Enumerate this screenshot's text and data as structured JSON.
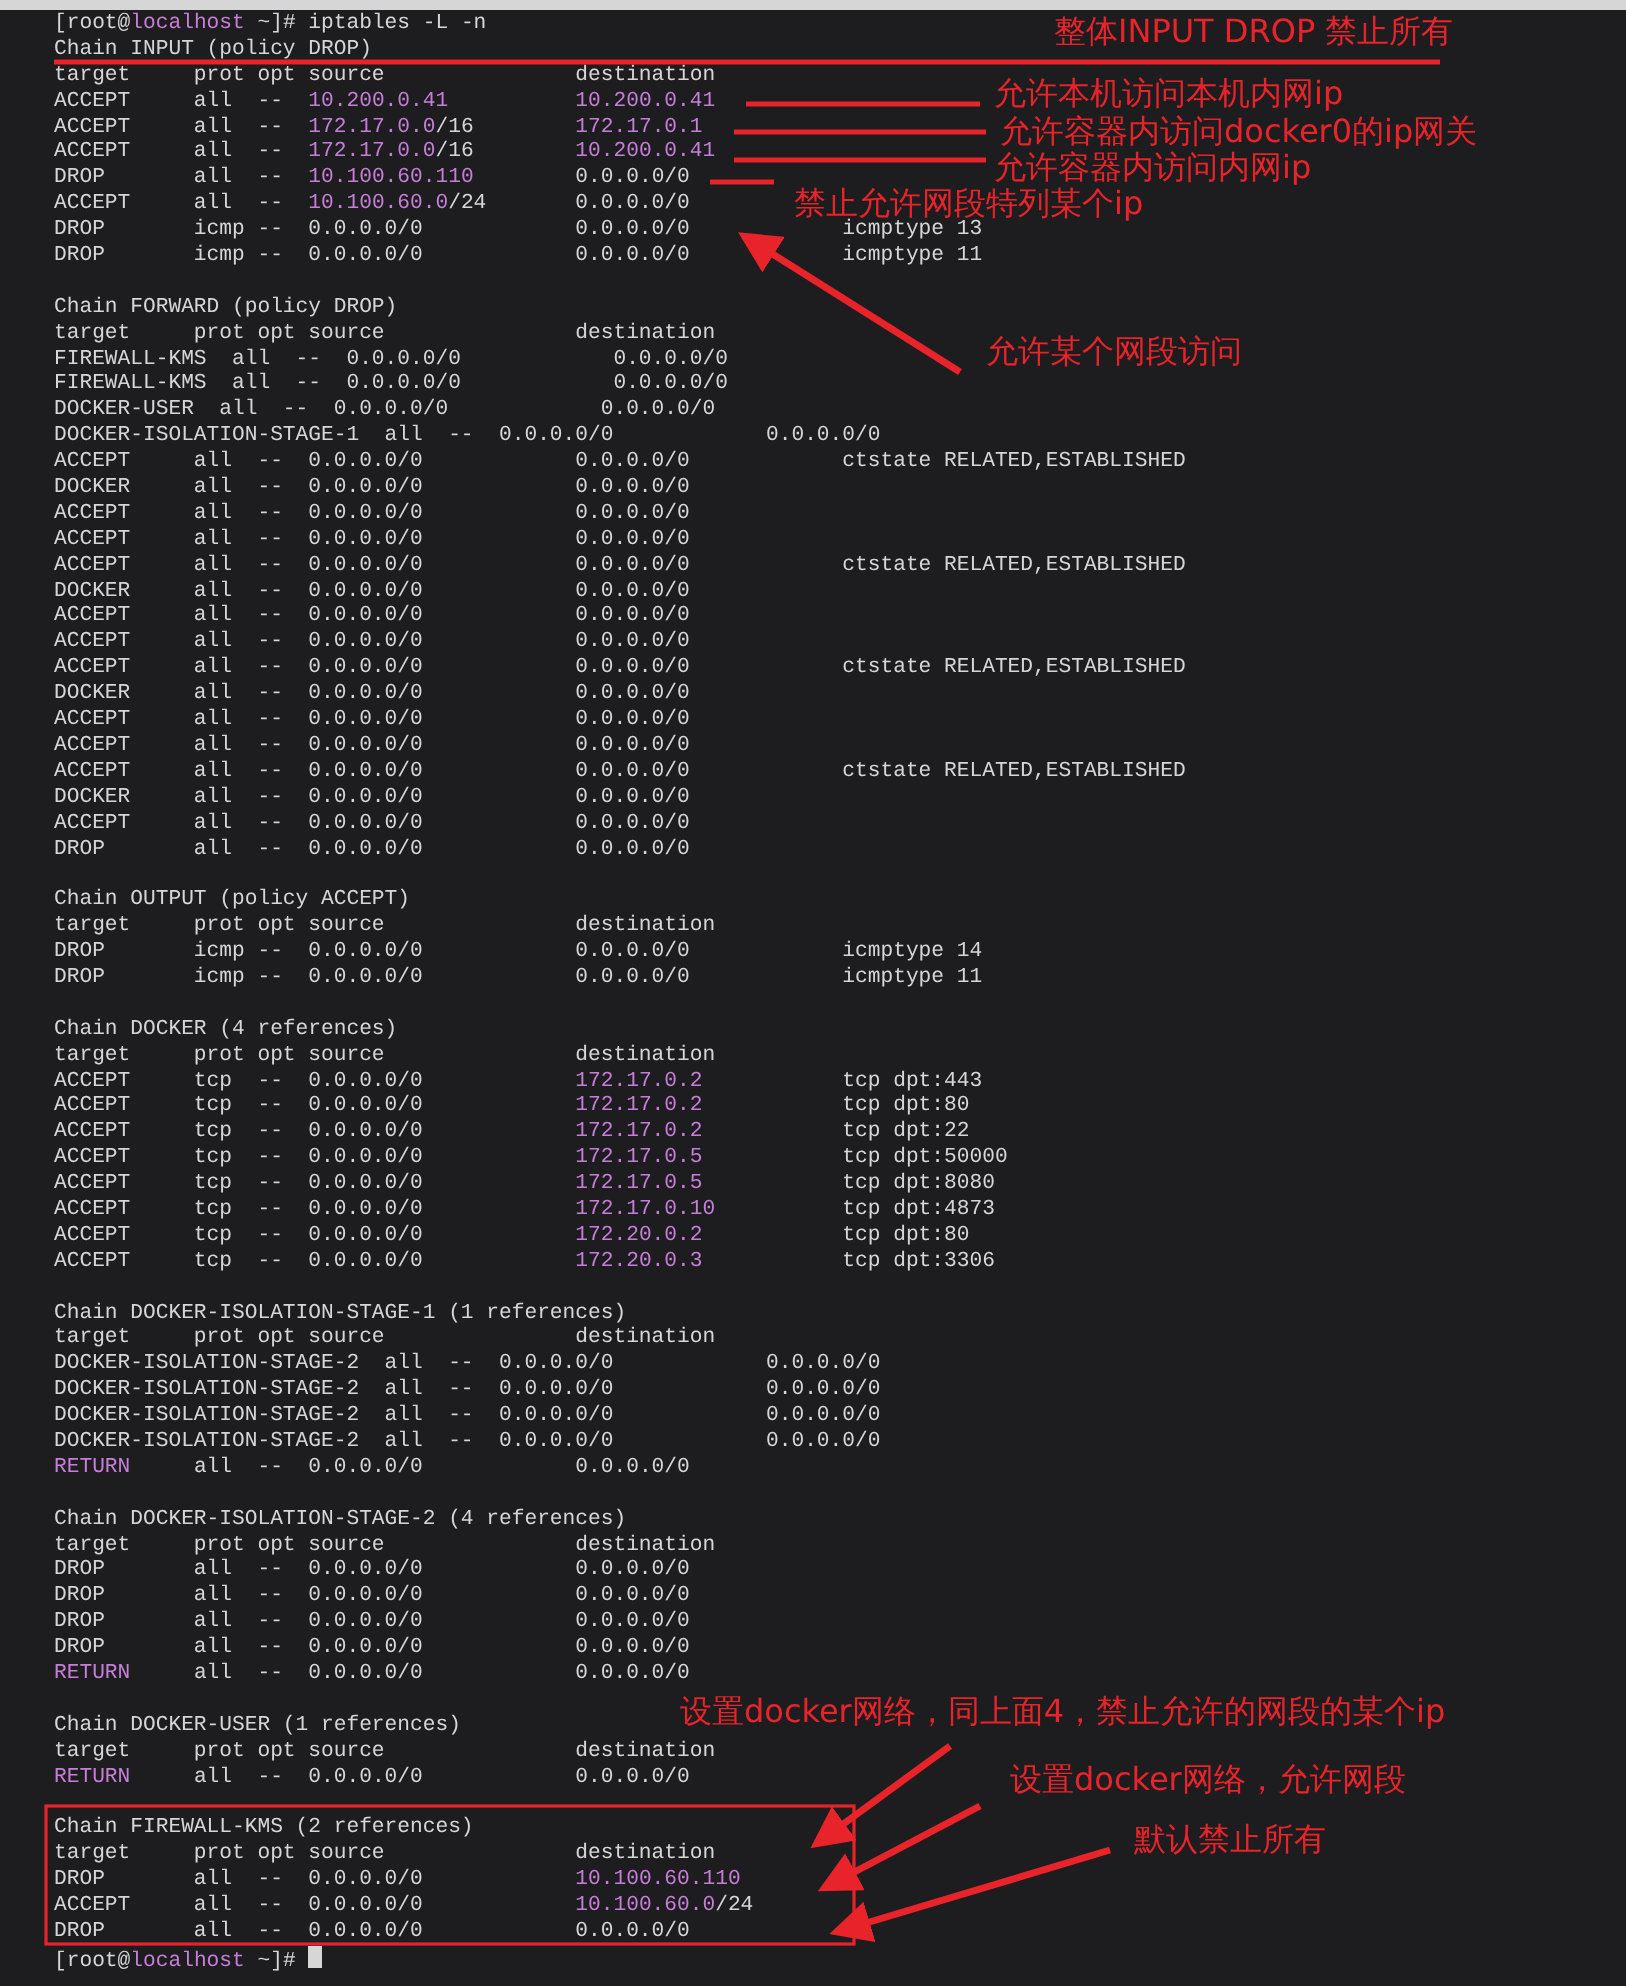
{
  "terminal": {
    "lines": [
      {
        "kind": "command",
        "parts": [
          {
            "text": "[root@",
            "highlight": false
          },
          {
            "text": "localhost",
            "highlight": true
          },
          {
            "text": " ~]# iptables -L -n",
            "highlight": false
          }
        ]
      },
      {
        "kind": "output",
        "text": "Chain INPUT (policy DROP)"
      },
      {
        "kind": "output",
        "text": "target     prot opt source               destination"
      },
      {
        "kind": "output",
        "parts": [
          {
            "text": "ACCEPT     all  --  ",
            "highlight": false
          },
          {
            "text": "10.200.0.41",
            "highlight": true
          },
          {
            "text": "          10.200.0.41",
            "highlight": true
          }
        ]
      },
      {
        "kind": "output",
        "parts": [
          {
            "text": "ACCEPT     all  --  ",
            "highlight": false
          },
          {
            "text": "172.17.0.0",
            "highlight": true
          },
          {
            "text": "/16        ",
            "highlight": false
          },
          {
            "text": "172.17.0.1",
            "highlight": true
          }
        ]
      },
      {
        "kind": "output",
        "parts": [
          {
            "text": "ACCEPT     all  --  ",
            "highlight": false
          },
          {
            "text": "172.17.0.0",
            "highlight": true
          },
          {
            "text": "/16        ",
            "highlight": false
          },
          {
            "text": "10.200.0.41",
            "highlight": true
          }
        ]
      },
      {
        "kind": "output",
        "parts": [
          {
            "text": "DROP       all  --  ",
            "highlight": false
          },
          {
            "text": "10.100.60.110",
            "highlight": true
          },
          {
            "text": "        0.0.0.0/0",
            "highlight": false
          }
        ]
      },
      {
        "kind": "output",
        "parts": [
          {
            "text": "ACCEPT     all  --  ",
            "highlight": false
          },
          {
            "text": "10.100.60.0",
            "highlight": true
          },
          {
            "text": "/24       0.0.0.0/0",
            "highlight": false
          }
        ]
      },
      {
        "kind": "output",
        "text": "DROP       icmp --  0.0.0.0/0            0.0.0.0/0            icmptype 13"
      },
      {
        "kind": "output",
        "text": "DROP       icmp --  0.0.0.0/0            0.0.0.0/0            icmptype 11"
      },
      {
        "kind": "blank"
      },
      {
        "kind": "output",
        "text": "Chain FORWARD (policy DROP)"
      },
      {
        "kind": "output",
        "text": "target     prot opt source               destination"
      },
      {
        "kind": "output",
        "text": "FIREWALL-KMS  all  --  0.0.0.0/0            0.0.0.0/0"
      },
      {
        "kind": "output",
        "text": "FIREWALL-KMS  all  --  0.0.0.0/0            0.0.0.0/0"
      },
      {
        "kind": "output",
        "text": "DOCKER-USER  all  --  0.0.0.0/0            0.0.0.0/0"
      },
      {
        "kind": "output",
        "text": "DOCKER-ISOLATION-STAGE-1  all  --  0.0.0.0/0            0.0.0.0/0"
      },
      {
        "kind": "output",
        "text": "ACCEPT     all  --  0.0.0.0/0            0.0.0.0/0            ctstate RELATED,ESTABLISHED"
      },
      {
        "kind": "output",
        "text": "DOCKER     all  --  0.0.0.0/0            0.0.0.0/0"
      },
      {
        "kind": "output",
        "text": "ACCEPT     all  --  0.0.0.0/0            0.0.0.0/0"
      },
      {
        "kind": "output",
        "text": "ACCEPT     all  --  0.0.0.0/0            0.0.0.0/0"
      },
      {
        "kind": "output",
        "text": "ACCEPT     all  --  0.0.0.0/0            0.0.0.0/0            ctstate RELATED,ESTABLISHED"
      },
      {
        "kind": "output",
        "text": "DOCKER     all  --  0.0.0.0/0            0.0.0.0/0"
      },
      {
        "kind": "output",
        "text": "ACCEPT     all  --  0.0.0.0/0            0.0.0.0/0"
      },
      {
        "kind": "output",
        "text": "ACCEPT     all  --  0.0.0.0/0            0.0.0.0/0"
      },
      {
        "kind": "output",
        "text": "ACCEPT     all  --  0.0.0.0/0            0.0.0.0/0            ctstate RELATED,ESTABLISHED"
      },
      {
        "kind": "output",
        "text": "DOCKER     all  --  0.0.0.0/0            0.0.0.0/0"
      },
      {
        "kind": "output",
        "text": "ACCEPT     all  --  0.0.0.0/0            0.0.0.0/0"
      },
      {
        "kind": "output",
        "text": "ACCEPT     all  --  0.0.0.0/0            0.0.0.0/0"
      },
      {
        "kind": "output",
        "text": "ACCEPT     all  --  0.0.0.0/0            0.0.0.0/0            ctstate RELATED,ESTABLISHED"
      },
      {
        "kind": "output",
        "text": "DOCKER     all  --  0.0.0.0/0            0.0.0.0/0"
      },
      {
        "kind": "output",
        "text": "ACCEPT     all  --  0.0.0.0/0            0.0.0.0/0"
      },
      {
        "kind": "output",
        "text": "DROP       all  --  0.0.0.0/0            0.0.0.0/0"
      },
      {
        "kind": "blank"
      },
      {
        "kind": "output",
        "text": "Chain OUTPUT (policy ACCEPT)"
      },
      {
        "kind": "output",
        "text": "target     prot opt source               destination"
      },
      {
        "kind": "output",
        "text": "DROP       icmp --  0.0.0.0/0            0.0.0.0/0            icmptype 14"
      },
      {
        "kind": "output",
        "text": "DROP       icmp --  0.0.0.0/0            0.0.0.0/0            icmptype 11"
      },
      {
        "kind": "blank"
      },
      {
        "kind": "output",
        "text": "Chain DOCKER (4 references)"
      },
      {
        "kind": "output",
        "text": "target     prot opt source               destination"
      },
      {
        "kind": "output",
        "parts": [
          {
            "text": "ACCEPT     tcp  --  0.0.0.0/0            ",
            "highlight": false
          },
          {
            "text": "172.17.0.2",
            "highlight": true
          },
          {
            "text": "           tcp dpt:443",
            "highlight": false
          }
        ]
      },
      {
        "kind": "output",
        "parts": [
          {
            "text": "ACCEPT     tcp  --  0.0.0.0/0            ",
            "highlight": false
          },
          {
            "text": "172.17.0.2",
            "highlight": true
          },
          {
            "text": "           tcp dpt:80",
            "highlight": false
          }
        ]
      },
      {
        "kind": "output",
        "parts": [
          {
            "text": "ACCEPT     tcp  --  0.0.0.0/0            ",
            "highlight": false
          },
          {
            "text": "172.17.0.2",
            "highlight": true
          },
          {
            "text": "           tcp dpt:22",
            "highlight": false
          }
        ]
      },
      {
        "kind": "output",
        "parts": [
          {
            "text": "ACCEPT     tcp  --  0.0.0.0/0            ",
            "highlight": false
          },
          {
            "text": "172.17.0.5",
            "highlight": true
          },
          {
            "text": "           tcp dpt:50000",
            "highlight": false
          }
        ]
      },
      {
        "kind": "output",
        "parts": [
          {
            "text": "ACCEPT     tcp  --  0.0.0.0/0            ",
            "highlight": false
          },
          {
            "text": "172.17.0.5",
            "highlight": true
          },
          {
            "text": "           tcp dpt:8080",
            "highlight": false
          }
        ]
      },
      {
        "kind": "output",
        "parts": [
          {
            "text": "ACCEPT     tcp  --  0.0.0.0/0            ",
            "highlight": false
          },
          {
            "text": "172.17.0.10",
            "highlight": true
          },
          {
            "text": "          tcp dpt:4873",
            "highlight": false
          }
        ]
      },
      {
        "kind": "output",
        "parts": [
          {
            "text": "ACCEPT     tcp  --  0.0.0.0/0            ",
            "highlight": false
          },
          {
            "text": "172.20.0.2",
            "highlight": true
          },
          {
            "text": "           tcp dpt:80",
            "highlight": false
          }
        ]
      },
      {
        "kind": "output",
        "parts": [
          {
            "text": "ACCEPT     tcp  --  0.0.0.0/0            ",
            "highlight": false
          },
          {
            "text": "172.20.0.3",
            "highlight": true
          },
          {
            "text": "           tcp dpt:3306",
            "highlight": false
          }
        ]
      },
      {
        "kind": "blank"
      },
      {
        "kind": "output",
        "text": "Chain DOCKER-ISOLATION-STAGE-1 (1 references)"
      },
      {
        "kind": "output",
        "text": "target     prot opt source               destination"
      },
      {
        "kind": "output",
        "text": "DOCKER-ISOLATION-STAGE-2  all  --  0.0.0.0/0            0.0.0.0/0"
      },
      {
        "kind": "output",
        "text": "DOCKER-ISOLATION-STAGE-2  all  --  0.0.0.0/0            0.0.0.0/0"
      },
      {
        "kind": "output",
        "text": "DOCKER-ISOLATION-STAGE-2  all  --  0.0.0.0/0            0.0.0.0/0"
      },
      {
        "kind": "output",
        "text": "DOCKER-ISOLATION-STAGE-2  all  --  0.0.0.0/0            0.0.0.0/0"
      },
      {
        "kind": "output",
        "parts": [
          {
            "text": "RETURN",
            "highlight": true
          },
          {
            "text": "     all  --  0.0.0.0/0            0.0.0.0/0",
            "highlight": false
          }
        ]
      },
      {
        "kind": "blank"
      },
      {
        "kind": "output",
        "text": "Chain DOCKER-ISOLATION-STAGE-2 (4 references)"
      },
      {
        "kind": "output",
        "text": "target     prot opt source               destination"
      },
      {
        "kind": "output",
        "text": "DROP       all  --  0.0.0.0/0            0.0.0.0/0"
      },
      {
        "kind": "output",
        "text": "DROP       all  --  0.0.0.0/0            0.0.0.0/0"
      },
      {
        "kind": "output",
        "text": "DROP       all  --  0.0.0.0/0            0.0.0.0/0"
      },
      {
        "kind": "output",
        "text": "DROP       all  --  0.0.0.0/0            0.0.0.0/0"
      },
      {
        "kind": "output",
        "parts": [
          {
            "text": "RETURN",
            "highlight": true
          },
          {
            "text": "     all  --  0.0.0.0/0            0.0.0.0/0",
            "highlight": false
          }
        ]
      },
      {
        "kind": "blank"
      },
      {
        "kind": "output",
        "text": "Chain DOCKER-USER (1 references)"
      },
      {
        "kind": "output",
        "text": "target     prot opt source               destination"
      },
      {
        "kind": "output",
        "parts": [
          {
            "text": "RETURN",
            "highlight": true
          },
          {
            "text": "     all  --  0.0.0.0/0            0.0.0.0/0",
            "highlight": false
          }
        ]
      },
      {
        "kind": "blank"
      },
      {
        "kind": "output",
        "text": "Chain FIREWALL-KMS (2 references)"
      },
      {
        "kind": "output",
        "text": "target     prot opt source               destination"
      },
      {
        "kind": "output",
        "parts": [
          {
            "text": "DROP       all  --  0.0.0.0/0            ",
            "highlight": false
          },
          {
            "text": "10.100.60.110",
            "highlight": true
          }
        ]
      },
      {
        "kind": "output",
        "parts": [
          {
            "text": "ACCEPT     all  --  0.0.0.0/0            ",
            "highlight": false
          },
          {
            "text": "10.100.60.0",
            "highlight": true
          },
          {
            "text": "/24",
            "highlight": false
          }
        ]
      },
      {
        "kind": "output",
        "text": "DROP       all  --  0.0.0.0/0            0.0.0.0/0"
      },
      {
        "kind": "prompt",
        "parts": [
          {
            "text": "[root@",
            "highlight": false
          },
          {
            "text": "localhost",
            "highlight": true
          },
          {
            "text": " ~]# ",
            "highlight": false
          }
        ]
      }
    ]
  },
  "annotations": [
    "整体INPUT DROP 禁止所有",
    "允许本机访问本机内网ip",
    "允许容器内访问docker0的ip网关",
    "允许容器内访问内网ip",
    "禁止允许网段特列某个ip",
    "允许某个网段访问",
    "设置docker网络，同上面4，禁止允许的网段的某个ip",
    "设置docker网络，允许网段",
    "默认禁止所有"
  ]
}
